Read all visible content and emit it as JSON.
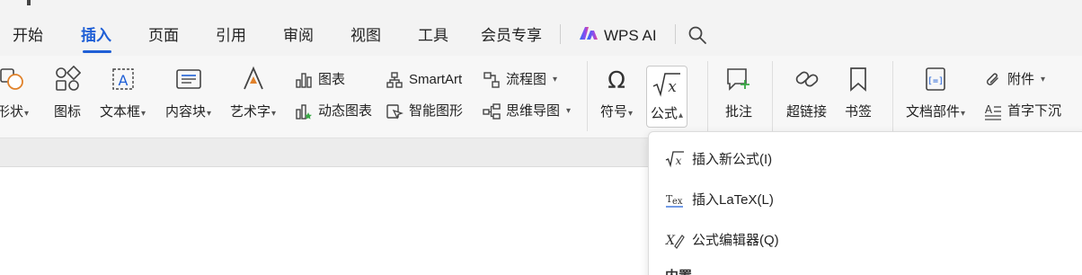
{
  "menu": {
    "tabs": [
      "开始",
      "插入",
      "页面",
      "引用",
      "审阅",
      "视图",
      "工具",
      "会员专享"
    ],
    "active_tab": "插入",
    "wps_ai": "WPS AI",
    "search_icon": "search-icon"
  },
  "ribbon": {
    "shape": "形状",
    "icons": "图标",
    "textbox": "文本框",
    "content_block": "内容块",
    "wordart": "艺术字",
    "chart": "图表",
    "dynamic_chart": "动态图表",
    "smartart": "SmartArt",
    "smart_graphic": "智能图形",
    "flowchart": "流程图",
    "mindmap": "思维导图",
    "symbol": "符号",
    "formula": "公式",
    "comment": "批注",
    "hyperlink": "超链接",
    "bookmark": "书签",
    "doc_parts": "文档部件",
    "attachment": "附件",
    "drop_cap": "首字下沉"
  },
  "formula_menu": {
    "items": [
      "插入新公式(I)",
      "插入LaTeX(L)",
      "公式编辑器(Q)"
    ],
    "section": "内置"
  },
  "colors": {
    "accent": "#1f5fd6",
    "icon_green": "#39a845",
    "icon_orange": "#e0812a"
  }
}
